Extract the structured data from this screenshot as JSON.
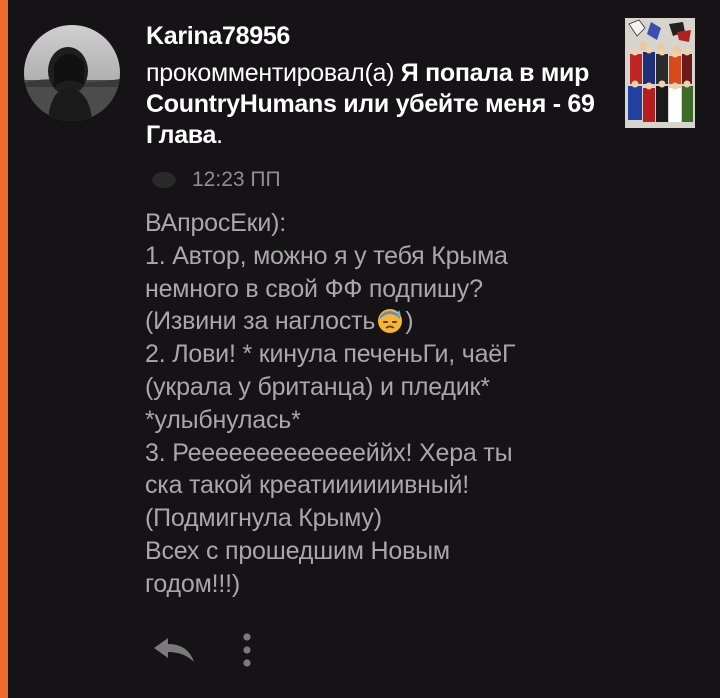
{
  "comment": {
    "username": "Karina78956",
    "action_verb": "прокомментировал(а)",
    "post_title": "Я попала в мир CountryHumans или убейте меня - 69 Глава",
    "title_end_punct": ".",
    "time": "12:23 ПП",
    "body_lines": [
      "ВАпросЕки):",
      "1. Автор, можно я у тебя Крыма",
      "немного в свой ФФ подпишу?",
      "(Извини за наглость",
      ")",
      "2. Лови! * кинула печеньГи, чаёГ",
      "(украла у британца) и пледик*",
      "*улыбнулась*",
      "3. Реееееееееееееййх! Хера ты",
      "ска такой креатиииииивный!",
      "(Подмигнула Крыму)",
      "Всех с прошедшим Новым",
      "годом!!!)"
    ],
    "emoji_name": "downcast-face-with-sweat-emoji"
  },
  "icons": {
    "accent_bar": "accent-bar",
    "avatar": "avatar",
    "thumbnail": "post-thumbnail",
    "clock": "clock-icon",
    "reply": "reply-icon",
    "more": "more-vertical-icon"
  },
  "colors": {
    "background": "#151315",
    "accent": "#f06b2c",
    "username": "#ffffff",
    "body": "#a8a8a8",
    "time": "#8f8f8f",
    "icons": "#7a7a7a"
  }
}
